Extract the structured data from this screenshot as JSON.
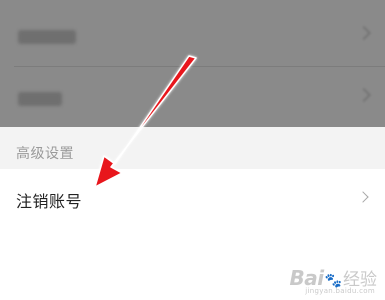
{
  "section_header": {
    "label": "高级设置"
  },
  "row": {
    "label": "注销账号",
    "chevron_icon": "chevron-right-icon"
  },
  "overlay": {
    "color": "#8a8a8a"
  },
  "annotation": {
    "arrow_color": "#e8141a",
    "icon": "arrow-pointer-icon"
  },
  "watermark": {
    "brand": "Bai",
    "mark": "🐾",
    "suffix": "经验",
    "url": "jingyan.baidu.com"
  }
}
